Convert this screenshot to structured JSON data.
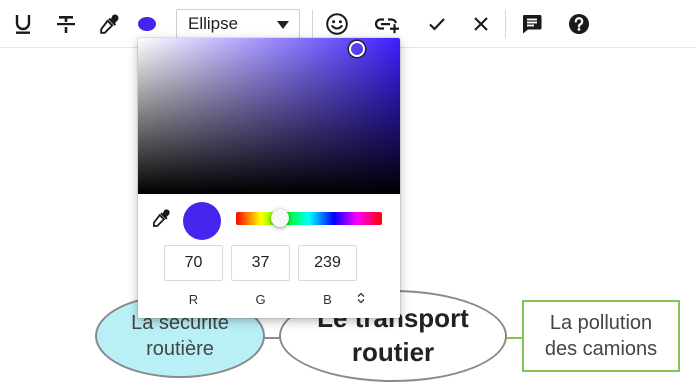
{
  "toolbar": {
    "shape_select": {
      "value": "Ellipse"
    },
    "current_color": "#4625ef",
    "icons": [
      "underline-icon",
      "strikethrough-icon",
      "eyedropper-icon",
      "color-swatch-icon",
      "chevron-down-icon",
      "emoji-icon",
      "link-add-icon",
      "check-icon",
      "close-icon",
      "comment-icon",
      "help-icon"
    ]
  },
  "color_picker": {
    "red": "70",
    "green": "37",
    "blue": "239",
    "labels": {
      "r": "R",
      "g": "G",
      "b": "B"
    },
    "hue_color": "#3d1fff",
    "selected_color": "#4625ef"
  },
  "mindmap": {
    "center": "Le transport routier",
    "left_node": "La sécurité routière",
    "right_node": "La pollution des camions",
    "left_fill": "#b8f0f6",
    "right_border": "#86c257"
  }
}
